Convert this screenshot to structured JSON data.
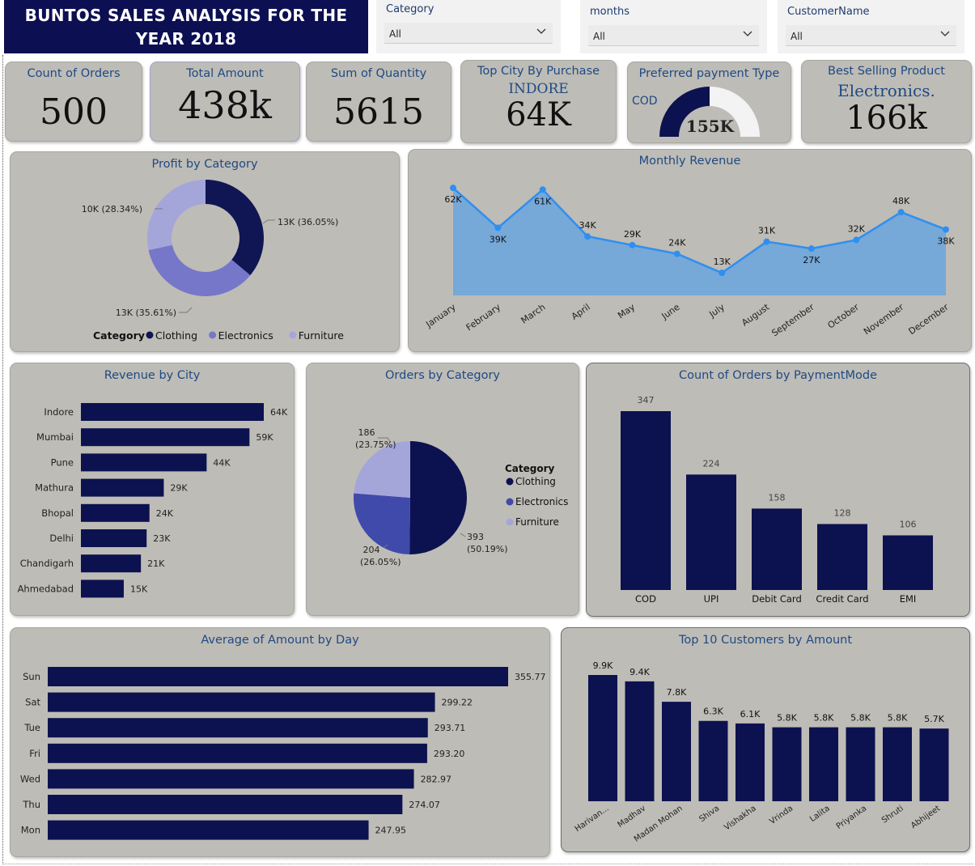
{
  "header": {
    "title_line1": "BUNTOS SALES ANALYSIS FOR THE",
    "title_line2": "YEAR 2018"
  },
  "slicers": [
    {
      "label": "Category",
      "value": "All"
    },
    {
      "label": "months",
      "value": "All"
    },
    {
      "label": "CustomerName",
      "value": "All"
    }
  ],
  "kpis": {
    "count_orders": {
      "label": "Count of Orders",
      "value": "500"
    },
    "total_amount": {
      "label": "Total Amount",
      "value": "438k"
    },
    "sum_quantity": {
      "label": "Sum of Quantity",
      "value": "5615"
    },
    "top_city": {
      "label": "Top City By Purchase",
      "sub": "INDORE",
      "value": "64K"
    },
    "payment": {
      "label": "Preferred payment Type",
      "sub": "COD",
      "value": "155K",
      "gauge_fraction": 0.5
    },
    "best_product": {
      "label": "Best Selling Product",
      "sub": "Electronics.",
      "value": "166k"
    }
  },
  "colors": {
    "navy": "#0c124f",
    "clothing": "#0f1653",
    "electronics": "#7677c9",
    "furniture": "#a4a6da",
    "orders_electronics": "#3f4aaa",
    "area_fill": "#76a8d8",
    "line": "#2f8ff0",
    "panel_bg": "#bebcb6"
  },
  "chart_data": [
    {
      "id": "profit_by_category",
      "type": "pie",
      "title": "Profit by Category",
      "legend_title": "Category",
      "legend_position": "bottom",
      "slices": [
        {
          "name": "Clothing",
          "value": 13,
          "label": "13K (36.05%)"
        },
        {
          "name": "Electronics",
          "value": 13,
          "label": "13K (35.61%)"
        },
        {
          "name": "Furniture",
          "value": 10,
          "label": "10K (28.34%)"
        }
      ],
      "percents": [
        36.05,
        35.61,
        28.34
      ]
    },
    {
      "id": "monthly_revenue",
      "type": "area",
      "title": "Monthly Revenue",
      "categories": [
        "January",
        "February",
        "March",
        "April",
        "May",
        "June",
        "July",
        "August",
        "September",
        "October",
        "November",
        "December"
      ],
      "values": [
        62,
        39,
        61,
        34,
        29,
        24,
        13,
        31,
        27,
        32,
        48,
        38
      ],
      "labels": [
        "62K",
        "39K",
        "61K",
        "34K",
        "29K",
        "24K",
        "13K",
        "31K",
        "27K",
        "32K",
        "48K",
        "38K"
      ],
      "ylim": [
        0,
        70
      ]
    },
    {
      "id": "revenue_by_city",
      "type": "bar",
      "orientation": "horizontal",
      "title": "Revenue by City",
      "categories": [
        "Indore",
        "Mumbai",
        "Pune",
        "Mathura",
        "Bhopal",
        "Delhi",
        "Chandigarh",
        "Ahmedabad"
      ],
      "values": [
        64,
        59,
        44,
        29,
        24,
        23,
        21,
        15
      ],
      "labels": [
        "64K",
        "59K",
        "44K",
        "29K",
        "24K",
        "23K",
        "21K",
        "15K"
      ]
    },
    {
      "id": "orders_by_category",
      "type": "pie",
      "title": "Orders by Category",
      "legend_title": "Category",
      "legend_position": "right",
      "slices": [
        {
          "name": "Clothing",
          "value": 393,
          "pct": "(50.19%)"
        },
        {
          "name": "Electronics",
          "value": 204,
          "pct": "(26.05%)"
        },
        {
          "name": "Furniture",
          "value": 186,
          "pct": "(23.75%)"
        }
      ]
    },
    {
      "id": "orders_by_payment",
      "type": "bar",
      "title": "Count of Orders by PaymentMode",
      "categories": [
        "COD",
        "UPI",
        "Debit Card",
        "Credit Card",
        "EMI"
      ],
      "values": [
        347,
        224,
        158,
        128,
        106
      ]
    },
    {
      "id": "avg_amount_by_day",
      "type": "bar",
      "orientation": "horizontal",
      "title": "Average of Amount by Day",
      "categories": [
        "Sun",
        "Sat",
        "Tue",
        "Fri",
        "Wed",
        "Thu",
        "Mon"
      ],
      "values": [
        355.77,
        299.22,
        293.71,
        293.2,
        282.97,
        274.07,
        247.95
      ],
      "labels": [
        "355.77",
        "299.22",
        "293.71",
        "293.20",
        "282.97",
        "274.07",
        "247.95"
      ]
    },
    {
      "id": "top_customers",
      "type": "bar",
      "title": "Top 10 Customers by Amount",
      "categories": [
        "Harivan...",
        "Madhav",
        "Madan Mohan",
        "Shiva",
        "Vishakha",
        "Vrinda",
        "Lalita",
        "Priyanka",
        "Shruti",
        "Abhijeet"
      ],
      "values": [
        9.9,
        9.4,
        7.8,
        6.3,
        6.1,
        5.8,
        5.8,
        5.8,
        5.8,
        5.7
      ],
      "labels": [
        "9.9K",
        "9.4K",
        "7.8K",
        "6.3K",
        "6.1K",
        "5.8K",
        "5.8K",
        "5.8K",
        "5.8K",
        "5.7K"
      ]
    }
  ]
}
